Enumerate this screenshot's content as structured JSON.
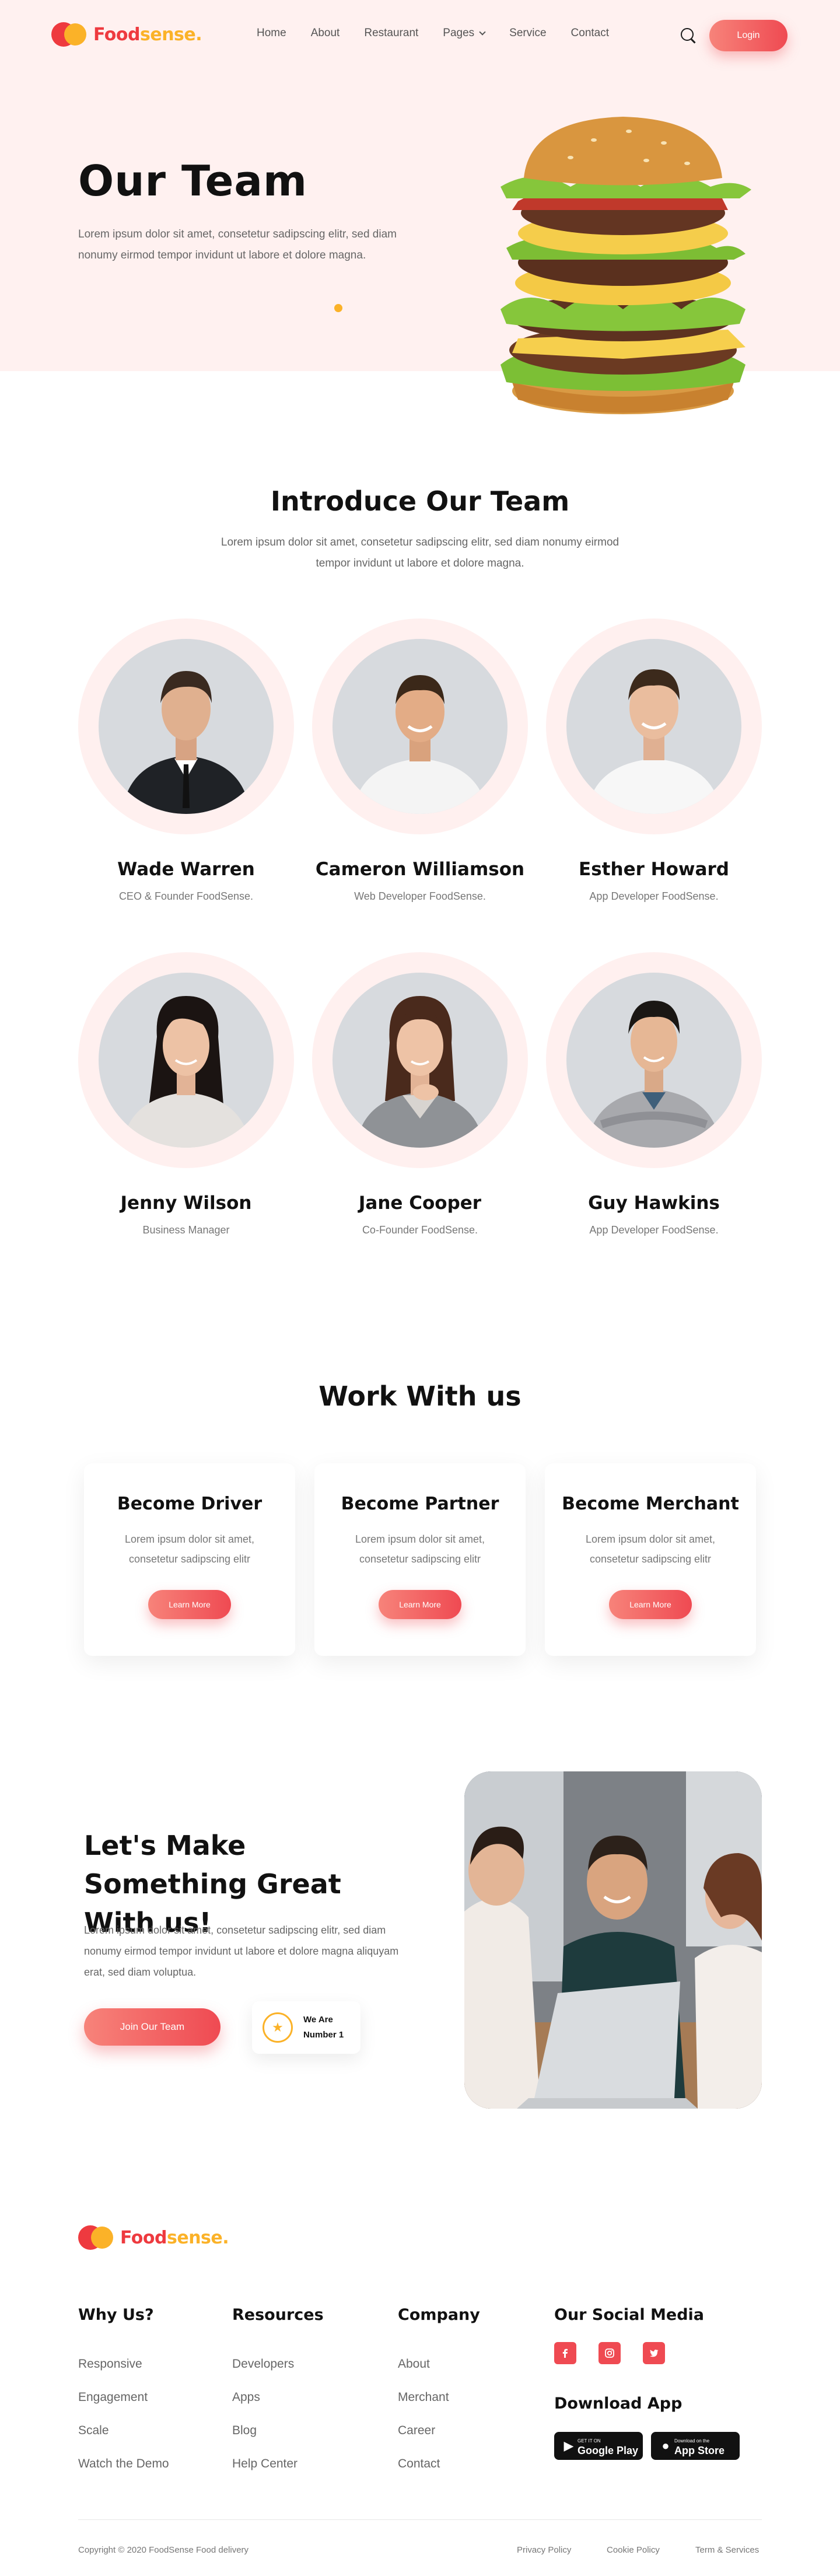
{
  "brand": {
    "name_part1": "Food",
    "name_part2": "sense."
  },
  "nav": {
    "items": [
      "Home",
      "About",
      "Restaurant",
      "Pages",
      "Service",
      "Contact"
    ],
    "login_label": "Login"
  },
  "hero": {
    "title": "Our Team",
    "description": "Lorem ipsum dolor sit amet, consetetur sadipscing elitr, sed diam nonumy eirmod tempor invidunt ut labore et dolore magna."
  },
  "team": {
    "title": "Introduce Our Team",
    "description": "Lorem ipsum dolor sit amet, consetetur sadipscing elitr, sed diam nonumy eirmod tempor invidunt ut labore et dolore magna.",
    "members": [
      {
        "name": "Wade Warren",
        "role": "CEO & Founder FoodSense."
      },
      {
        "name": "Cameron Williamson",
        "role": "Web Developer FoodSense."
      },
      {
        "name": "Esther Howard",
        "role": "App Developer FoodSense."
      },
      {
        "name": "Jenny Wilson",
        "role": "Business Manager"
      },
      {
        "name": "Jane Cooper",
        "role": "Co-Founder FoodSense."
      },
      {
        "name": "Guy Hawkins",
        "role": "App Developer FoodSense."
      }
    ]
  },
  "work": {
    "title": "Work With us",
    "cards": [
      {
        "title": "Become Driver",
        "description": "Lorem ipsum dolor sit amet, consetetur sadipscing elitr",
        "button": "Learn More"
      },
      {
        "title": "Become Partner",
        "description": "Lorem ipsum dolor sit amet, consetetur sadipscing elitr",
        "button": "Learn More"
      },
      {
        "title": "Become Merchant",
        "description": "Lorem ipsum dolor sit amet, consetetur sadipscing elitr",
        "button": "Learn More"
      }
    ]
  },
  "cta": {
    "title": "Let's Make Something Great With us!",
    "description": "Lorem ipsum dolor sit amet, consetetur sadipscing elitr, sed diam nonumy eirmod tempor invidunt ut labore et dolore magna aliquyam erat, sed diam voluptua.",
    "button": "Join Our Team",
    "badge": "We Are Number 1"
  },
  "footer": {
    "columns": [
      {
        "title": "Why Us?",
        "links": [
          "Responsive",
          "Engagement",
          "Scale",
          "Watch the Demo"
        ]
      },
      {
        "title": "Resources",
        "links": [
          "Developers",
          "Apps",
          "Blog",
          "Help Center"
        ]
      },
      {
        "title": "Company",
        "links": [
          "About",
          "Merchant",
          "Career",
          "Contact"
        ]
      }
    ],
    "social_title": "Our Social Media",
    "social_icons": [
      "facebook-icon",
      "instagram-icon",
      "twitter-icon"
    ],
    "download_title": "Download App",
    "google_play": {
      "small": "GET IT ON",
      "big": "Google Play"
    },
    "app_store": {
      "small": "Download on the",
      "big": "App Store"
    },
    "copyright": "Copyright © 2020 FoodSense Food delivery",
    "legal": [
      "Privacy Policy",
      "Cookie Policy",
      "Term & Services"
    ]
  },
  "colors": {
    "primary": "#ef4a52",
    "accent": "#fbb228",
    "hero_bg": "#fff1f0"
  }
}
